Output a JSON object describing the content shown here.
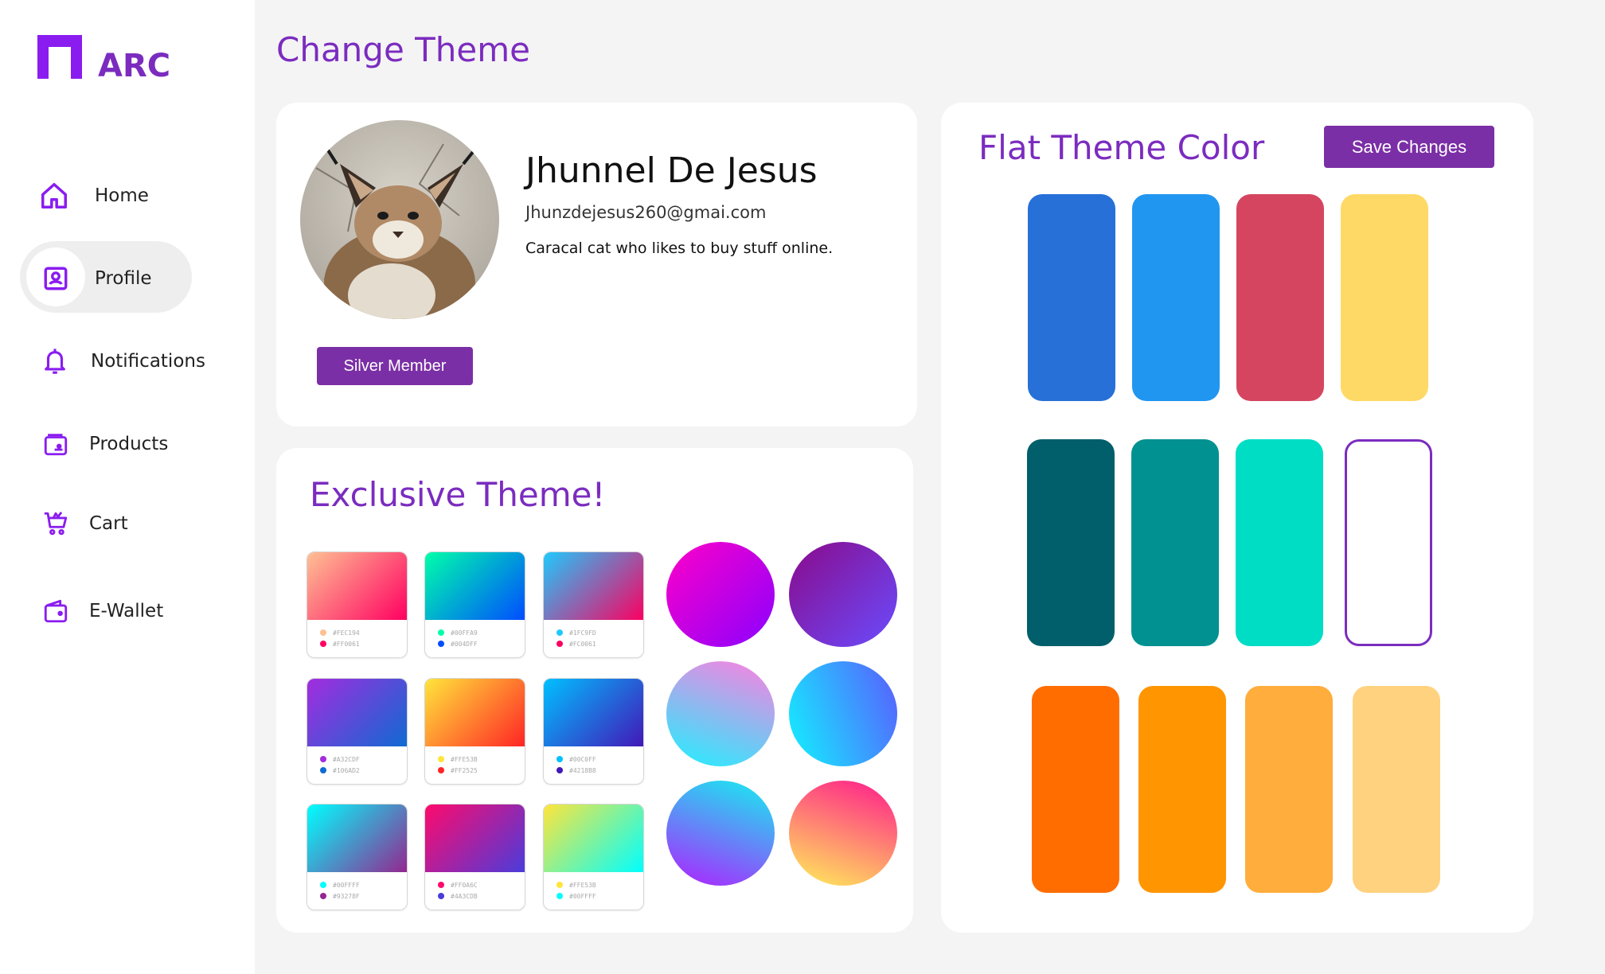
{
  "app": {
    "logo_text": "ARC"
  },
  "page": {
    "title": "Change Theme"
  },
  "sidebar": {
    "items": [
      {
        "label": "Home",
        "icon": "home-icon"
      },
      {
        "label": "Profile",
        "icon": "profile-icon",
        "active": true
      },
      {
        "label": "Notifications",
        "icon": "bell-icon"
      },
      {
        "label": "Products",
        "icon": "products-icon"
      },
      {
        "label": "Cart",
        "icon": "cart-icon"
      },
      {
        "label": "E-Wallet",
        "icon": "wallet-icon"
      }
    ]
  },
  "profile": {
    "name": "Jhunnel De Jesus",
    "email": "Jhunzdejesus260@gmai.com",
    "bio": "Caracal cat who likes to buy stuff online.",
    "membership": "Silver Member"
  },
  "exclusive": {
    "title": "Exclusive Theme!",
    "gradient_cards": [
      {
        "colors": [
          "#FEC194",
          "#FF0061"
        ]
      },
      {
        "colors": [
          "#00FFA9",
          "#004DFF"
        ]
      },
      {
        "colors": [
          "#1FC9FD",
          "#FC0061"
        ]
      },
      {
        "colors": [
          "#A32CDF",
          "#106AD2"
        ]
      },
      {
        "colors": [
          "#FFE53B",
          "#FF2525"
        ]
      },
      {
        "colors": [
          "#00C0FF",
          "#4218B8"
        ]
      },
      {
        "colors": [
          "#00FFFF",
          "#93278F"
        ]
      },
      {
        "colors": [
          "#FF0A6C",
          "#4A3CDB"
        ]
      },
      {
        "colors": [
          "#FFE53B",
          "#00FFFF"
        ]
      }
    ],
    "gradient_circles": [
      {
        "colors": [
          "#ff00c8",
          "#8a00ff"
        ]
      },
      {
        "colors": [
          "#8a0a8a",
          "#6a4cff"
        ]
      },
      {
        "colors": [
          "#ff80e0",
          "#1ff0ff"
        ]
      },
      {
        "colors": [
          "#5a5cff",
          "#11f3ff"
        ]
      },
      {
        "colors": [
          "#15f0f0",
          "#b020ff"
        ]
      },
      {
        "colors": [
          "#ffef5a",
          "#ff1a8c"
        ]
      }
    ]
  },
  "flat": {
    "title": "Flat Theme Color",
    "save_label": "Save Changes",
    "swatches": [
      "#2670d8",
      "#2196f0",
      "#d64560",
      "#ffd966",
      "#005f6b",
      "#009190",
      "#00ddc5",
      "#ffffff",
      "#ff6d00",
      "#ff9500",
      "#ffad3c",
      "#ffd280"
    ],
    "selected_index": 7
  },
  "colors": {
    "accent": "#7b2cbf",
    "button": "#7b2fa6"
  }
}
